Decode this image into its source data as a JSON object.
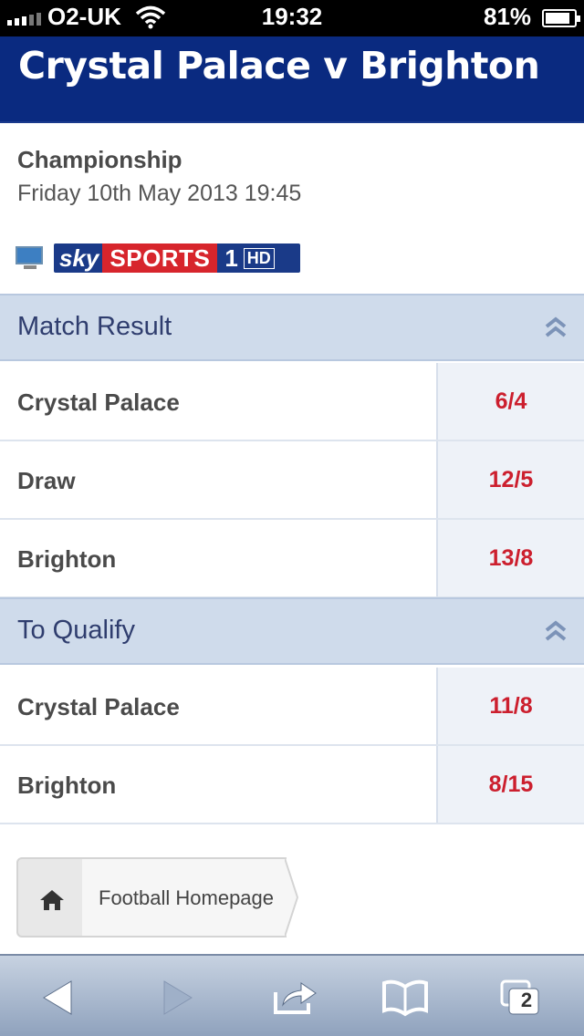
{
  "status_bar": {
    "carrier": "O2-UK",
    "time": "19:32",
    "battery": "81%",
    "battery_level": 0.81
  },
  "header": {
    "title": "Crystal Palace v Brighton"
  },
  "match_info": {
    "competition": "Championship",
    "datetime": "Friday 10th May 2013 19:45",
    "channel": {
      "sky": "sky",
      "sports": "SPORTS",
      "number": "1",
      "hd": "HD"
    }
  },
  "markets": [
    {
      "title": "Match Result",
      "selections": [
        {
          "name": "Crystal Palace",
          "odds": "6/4"
        },
        {
          "name": "Draw",
          "odds": "12/5"
        },
        {
          "name": "Brighton",
          "odds": "13/8"
        }
      ]
    },
    {
      "title": "To Qualify",
      "selections": [
        {
          "name": "Crystal Palace",
          "odds": "11/8"
        },
        {
          "name": "Brighton",
          "odds": "8/15"
        }
      ]
    }
  ],
  "breadcrumb": {
    "link_label": "Football Homepage"
  },
  "toolbar": {
    "tabs_count": "2"
  },
  "colors": {
    "header_bg": "#0a2a80",
    "odds_text": "#cc1f2e",
    "section_bg": "#cfdbeb"
  }
}
